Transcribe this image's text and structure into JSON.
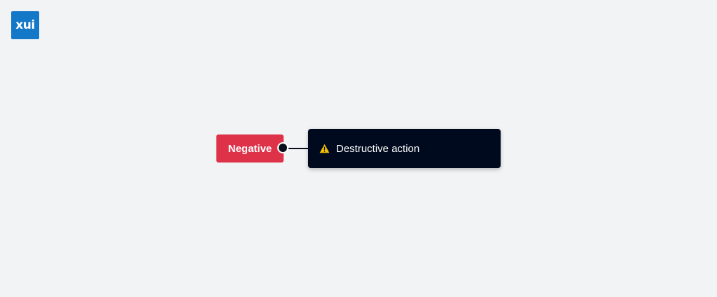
{
  "logo": {
    "text": "xui",
    "color": "#1478c8"
  },
  "button": {
    "label": "Negative",
    "color": "#de3249"
  },
  "tooltip": {
    "icon": "warning-icon",
    "text": "Destructive action",
    "background": "#000a1e",
    "icon_color": "#f5c000"
  }
}
